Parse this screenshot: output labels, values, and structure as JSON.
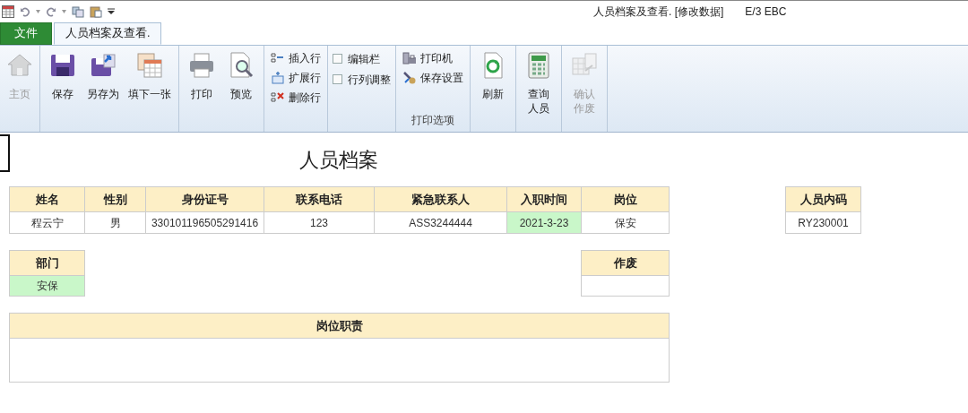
{
  "window": {
    "title": "人员档案及查看. [修改数据]",
    "user": "E/3 EBC"
  },
  "tabs": [
    {
      "label": "文件",
      "kind": "file",
      "selected": false
    },
    {
      "label": "人员档案及查看.",
      "kind": "tab",
      "selected": true
    }
  ],
  "ribbon_groups": [
    {
      "items": [
        {
          "kind": "large",
          "label": "主页",
          "disabled": true
        }
      ]
    },
    {
      "items": [
        {
          "kind": "large",
          "label": "保存",
          "disabled": false
        },
        {
          "kind": "large",
          "label": "另存为",
          "disabled": false
        },
        {
          "kind": "large",
          "label": "填下一张",
          "disabled": false
        }
      ]
    },
    {
      "items": [
        {
          "kind": "large",
          "label": "打印",
          "disabled": false
        },
        {
          "kind": "large",
          "label": "预览",
          "disabled": false
        }
      ]
    },
    {
      "items": [
        {
          "kind": "small",
          "label": "插入行"
        },
        {
          "kind": "small",
          "label": "扩展行"
        },
        {
          "kind": "small",
          "label": "删除行"
        }
      ]
    },
    {
      "items": [
        {
          "kind": "check",
          "label": "编辑栏",
          "checked": false
        },
        {
          "kind": "check",
          "label": "行列调整",
          "checked": false
        }
      ]
    },
    {
      "label": "打印选项",
      "items": [
        {
          "kind": "small",
          "label": "打印机"
        },
        {
          "kind": "small",
          "label": "保存设置"
        }
      ]
    },
    {
      "items": [
        {
          "kind": "large",
          "label": "刷新",
          "disabled": false
        }
      ]
    },
    {
      "items": [
        {
          "kind": "large",
          "label": "查询人员",
          "disabled": false
        }
      ]
    },
    {
      "items": [
        {
          "kind": "large",
          "label": "确认作废",
          "disabled": true
        }
      ]
    }
  ],
  "sheet": {
    "title": "人员档案",
    "fields": [
      {
        "label": "姓名",
        "value": "程云宁",
        "highlighted": false
      },
      {
        "label": "性别",
        "value": "男",
        "highlighted": false
      },
      {
        "label": "身份证号",
        "value": "330101196505291416",
        "highlighted": false
      },
      {
        "label": "联系电话",
        "value": "123",
        "highlighted": false
      },
      {
        "label": "紧急联系人",
        "value": "ASS3244444",
        "highlighted": false
      },
      {
        "label": "入职时间",
        "value": "2021-3-23",
        "highlighted": true
      },
      {
        "label": "岗位",
        "value": "保安",
        "highlighted": false
      },
      {
        "label": "人员内码",
        "value": "RY230001",
        "highlighted": false
      },
      {
        "label": "部门",
        "value": "安保",
        "highlighted": true
      },
      {
        "label": "作废",
        "highlighted": false
      },
      {
        "label": "岗位职责",
        "highlighted": false
      }
    ]
  }
}
